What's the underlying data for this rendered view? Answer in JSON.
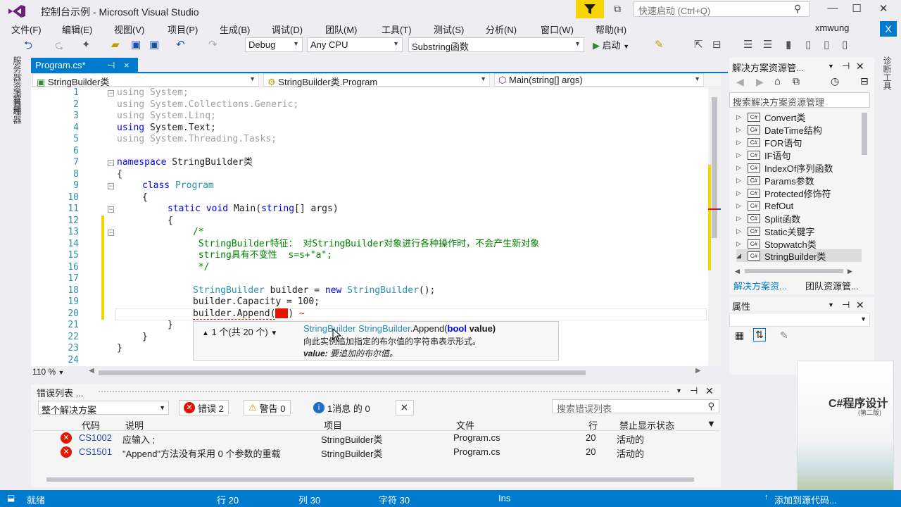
{
  "window": {
    "title": "控制台示例 - Microsoft Visual Studio",
    "quick_launch_placeholder": "快速启动 (Ctrl+Q)",
    "user": "xmwung",
    "user_badge": "X"
  },
  "menu": [
    "文件(F)",
    "编辑(E)",
    "视图(V)",
    "项目(P)",
    "生成(B)",
    "调试(D)",
    "团队(M)",
    "工具(T)",
    "测试(S)",
    "分析(N)",
    "窗口(W)",
    "帮助(H)"
  ],
  "toolbar": {
    "config": "Debug",
    "platform": "Any CPU",
    "startup": "Substring函数",
    "run_label": "启动"
  },
  "left_tabs": [
    "服务器资源管理器",
    "工具箱"
  ],
  "right_tabs": [
    "诊断工具"
  ],
  "doc_tab": {
    "label": "Program.cs*",
    "pin": "⊣",
    "close": "×"
  },
  "nav": {
    "project": "StringBuilder类",
    "class": "StringBuilder类.Program",
    "member": "Main(string[] args)"
  },
  "code": {
    "line_numbers": [
      "1",
      "2",
      "3",
      "4",
      "5",
      "6",
      "7",
      "8",
      "9",
      "10",
      "11",
      "12",
      "13",
      "14",
      "15",
      "16",
      "17",
      "18",
      "19",
      "20",
      "21",
      "22",
      "23",
      "24"
    ],
    "l1_kw": "using",
    "l1_rest": " System;",
    "l2_kw": "using",
    "l2_rest": " System.Collections.Generic;",
    "l3_kw": "using",
    "l3_rest": " System.Linq;",
    "l4_kw": "using",
    "l4_rest": " System.Text;",
    "l5_kw": "using",
    "l5_rest": " System.Threading.Tasks;",
    "l7_kw": "namespace",
    "l7_rest": " StringBuilder类",
    "l8": "{",
    "l9_kw": "class",
    "l9_ty": "Program",
    "l10": "{",
    "l11_kw1": "static",
    "l11_kw2": "void",
    "l11_a": " Main(",
    "l11_kw3": "string",
    "l11_b": "[] args)",
    "l12": "{",
    "l13": "/*",
    "l14": " StringBuilder特征： 对StringBuilder对象进行各种操作时，不会产生新对象",
    "l15": " string具有不变性  s=s+\"a\";",
    "l16": " */",
    "l18_ty": "StringBuilder",
    "l18_a": " builder = ",
    "l18_kw": "new",
    "l18_ty2": " StringBuilder",
    "l18_b": "();",
    "l19": "builder.Capacity = 100;",
    "l20": "builder.Append(",
    "l20_end": ")",
    "l21": "}",
    "l22": "}",
    "l23": "}"
  },
  "tooltip": {
    "counter": "1 个(共 20 个)",
    "signature_type": "StringBuilder StringBuilder",
    "signature_method": ".Append(",
    "signature_kw": "bool",
    "signature_param": " value)",
    "description": "向此实例追加指定的布尔值的字符串表示形式。",
    "param_name": "value:",
    "param_desc": " 要追加的布尔值。"
  },
  "zoom": "110 %",
  "error_list": {
    "title": "错误列表 ...",
    "scope": "整个解决方案",
    "errors_label": "错误 2",
    "warnings_label": "警告 0",
    "messages_label": "1消息 的 0",
    "search_placeholder": "搜索错误列表",
    "columns": [
      "代码",
      "说明",
      "项目",
      "文件",
      "行",
      "禁止显示状态"
    ],
    "rows": [
      {
        "code": "CS1002",
        "desc": "应输入 ;",
        "project": "StringBuilder类",
        "file": "Program.cs",
        "line": "20",
        "state": "活动的"
      },
      {
        "code": "CS1501",
        "desc": "\"Append\"方法没有采用 0 个参数的重载",
        "project": "StringBuilder类",
        "file": "Program.cs",
        "line": "20",
        "state": "活动的"
      }
    ]
  },
  "solution": {
    "title": "解决方案资源管...",
    "search_placeholder": "搜索解决方案资源管理",
    "items": [
      "Convert类",
      "DateTime结构",
      "FOR语句",
      "IF语句",
      "IndexOf序列函数",
      "Params参数",
      "Protected修饰符",
      "RefOut",
      "Split函数",
      "Static关键字",
      "Stopwatch类",
      "StringBuilder类"
    ],
    "tab1": "解决方案资...",
    "tab2": "团队资源管..."
  },
  "properties": {
    "title": "属性"
  },
  "book": {
    "title": "C#程序设计",
    "subtitle": "(第二版)"
  },
  "status": {
    "ready": "就绪",
    "line": "行 20",
    "col": "列 30",
    "char": "字符 30",
    "mode": "Ins",
    "publish": "添加到源代码..."
  }
}
